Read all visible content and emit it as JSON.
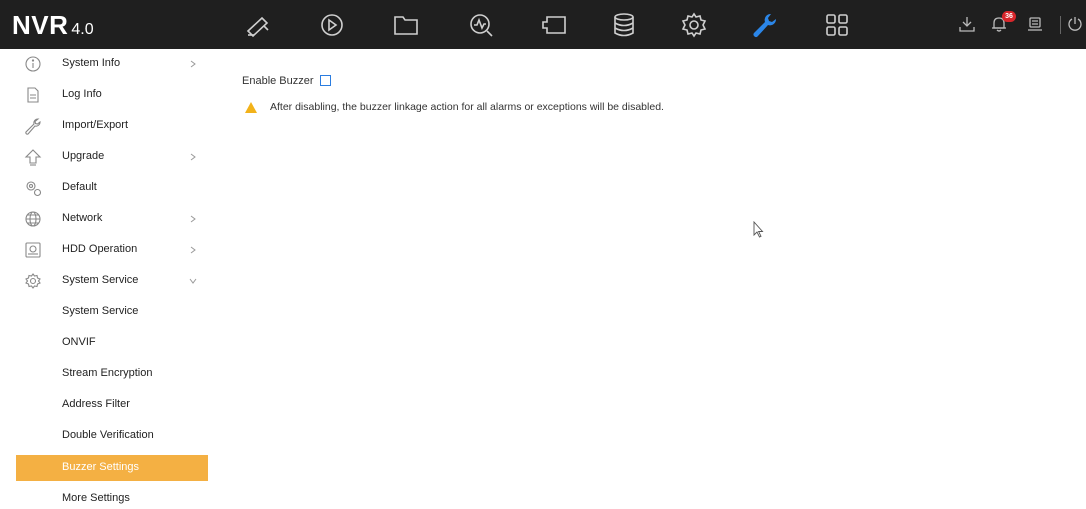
{
  "app": {
    "logo_main": "NVR",
    "logo_version": "4.0"
  },
  "topnav": {
    "icons": [
      "live-view-camera-icon",
      "playback-icon",
      "file-management-icon",
      "smart-analysis-icon",
      "screen-icon",
      "storage-icon",
      "configuration-gear-icon",
      "maintenance-wrench-icon",
      "grid-menu-icon"
    ],
    "active_icon": "maintenance-wrench-icon",
    "active_color": "#2b86e8"
  },
  "right_icons": {
    "alarm_count": "36"
  },
  "sidebar": {
    "items": [
      {
        "label": "System Info",
        "icon": "info-icon",
        "has_chevron": true
      },
      {
        "label": "Log Info",
        "icon": "document-icon",
        "has_chevron": false
      },
      {
        "label": "Import/Export",
        "icon": "wrench-icon",
        "has_chevron": false
      },
      {
        "label": "Upgrade",
        "icon": "upgrade-arrow-icon",
        "has_chevron": true
      },
      {
        "label": "Default",
        "icon": "default-gears-icon",
        "has_chevron": false
      },
      {
        "label": "Network",
        "icon": "globe-icon",
        "has_chevron": true
      },
      {
        "label": "HDD Operation",
        "icon": "hdd-icon",
        "has_chevron": true
      },
      {
        "label": "System Service",
        "icon": "service-gear-icon",
        "has_chevron": true,
        "expanded": true
      }
    ],
    "sub_items": [
      {
        "label": "System Service"
      },
      {
        "label": "ONVIF"
      },
      {
        "label": "Stream Encryption"
      },
      {
        "label": "Address Filter"
      },
      {
        "label": "Double Verification"
      },
      {
        "label": "Buzzer Settings",
        "active": true
      },
      {
        "label": "More Settings"
      }
    ],
    "active_color": "#f4b043"
  },
  "main": {
    "enable_buzzer_label": "Enable Buzzer",
    "enable_buzzer_checked": false,
    "warning_text": "After disabling, the buzzer linkage action for all alarms or exceptions will be disabled."
  }
}
